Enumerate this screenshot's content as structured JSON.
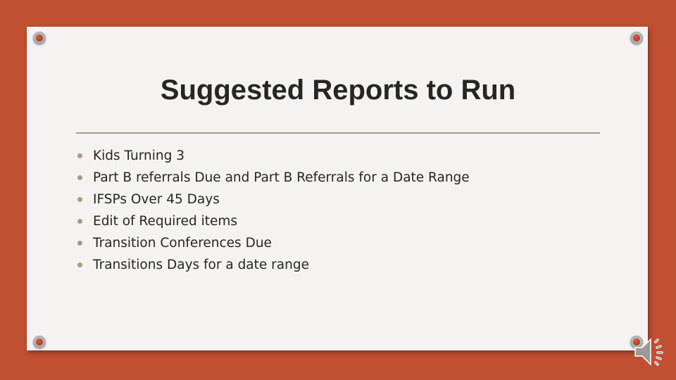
{
  "slide": {
    "title": "Suggested Reports to Run",
    "bullets": [
      "Kids Turning 3",
      "Part B referrals  Due and Part B Referrals for a Date Range",
      "IFSPs Over 45 Days",
      "Edit of Required items",
      "Transition Conferences Due",
      "Transitions Days for a date range"
    ]
  },
  "colors": {
    "background": "#c14f31",
    "paper": "#f4f3f2",
    "accent": "#a89a7c",
    "text": "#262626"
  },
  "icons": [
    "pushpin-icon",
    "speaker-icon"
  ]
}
